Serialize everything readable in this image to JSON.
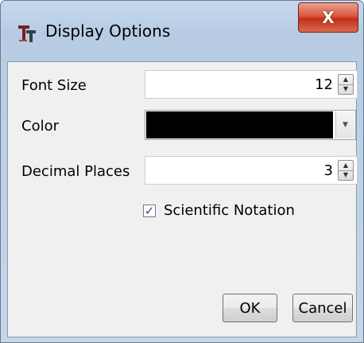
{
  "window": {
    "title": "Display Options",
    "close_label": "X"
  },
  "icons": {
    "app": "app-logo-icon",
    "close": "close-icon",
    "spin_up": "spin-up-icon",
    "spin_down": "spin-down-icon",
    "dropdown": "chevron-down-icon",
    "check": "checkmark-icon"
  },
  "form": {
    "font_size_label": "Font Size",
    "font_size_value": "12",
    "color_label": "Color",
    "color_value": "#000000",
    "decimal_places_label": "Decimal Places",
    "decimal_places_value": "3",
    "scientific_notation_label": "Scientific Notation",
    "scientific_notation_checked": true
  },
  "buttons": {
    "ok": "OK",
    "cancel": "Cancel"
  },
  "colors": {
    "title_bar": "#c2d5ea",
    "close_button": "#c9452a",
    "client_background": "#f0f0f0",
    "check_mark": "#2b3f7c"
  }
}
